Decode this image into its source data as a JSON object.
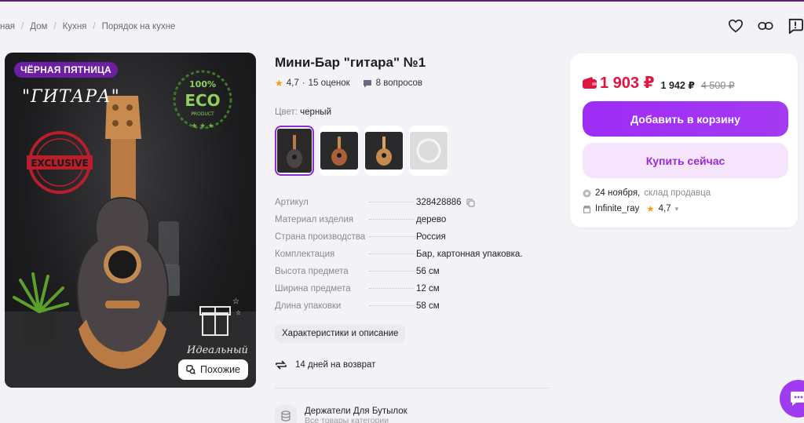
{
  "breadcrumb": [
    "ная",
    "Дом",
    "Кухня",
    "Порядок на кухне"
  ],
  "top_actions": [
    "heart-icon",
    "link-icon",
    "report-icon"
  ],
  "photo": {
    "badge": "ЧЁРНАЯ ПЯТНИЦА",
    "title": "\"ГИТАРА\"",
    "eco_text": "ECO",
    "exclusive_text": "EXCLUSIVE",
    "gift_caption": "Идеальный",
    "similar_label": "Похожие"
  },
  "product": {
    "title": "Мини-Бар \"гитара\" №1",
    "rating": "4,7",
    "reviews": "15 оценок",
    "questions": "8 вопросов",
    "color_label": "Цвет:",
    "color_value": "черный",
    "thumbnails": [
      "черный",
      "вариант 2",
      "вариант 3",
      "вариант 4"
    ]
  },
  "specs": [
    {
      "key": "Артикул",
      "value": "328428886"
    },
    {
      "key": "Материал изделия",
      "value": "дерево"
    },
    {
      "key": "Страна производства",
      "value": "Россия"
    },
    {
      "key": "Комплектация",
      "value": "Бар, картонная упаковка."
    },
    {
      "key": "Высота предмета",
      "value": "56 см"
    },
    {
      "key": "Ширина предмета",
      "value": "12 см"
    },
    {
      "key": "Длина упаковки",
      "value": "58 см"
    }
  ],
  "chars_button": "Характеристики и описание",
  "return_text": "14 дней на возврат",
  "category": {
    "name": "Держатели Для Бутылок",
    "sub": "Все товары категории"
  },
  "card": {
    "price": "1 903 ₽",
    "price_alt": "1 942 ₽",
    "price_old": "4 500 ₽",
    "add_to_cart": "Добавить в корзину",
    "buy_now": "Купить сейчас",
    "delivery_date": "24 ноября,",
    "delivery_source": "склад продавца",
    "seller": "Infinite_ray",
    "seller_rating": "4,7"
  },
  "colors": {
    "accent": "#9b2bff",
    "price": "#e0153f",
    "badge": "#6c1fa3"
  }
}
